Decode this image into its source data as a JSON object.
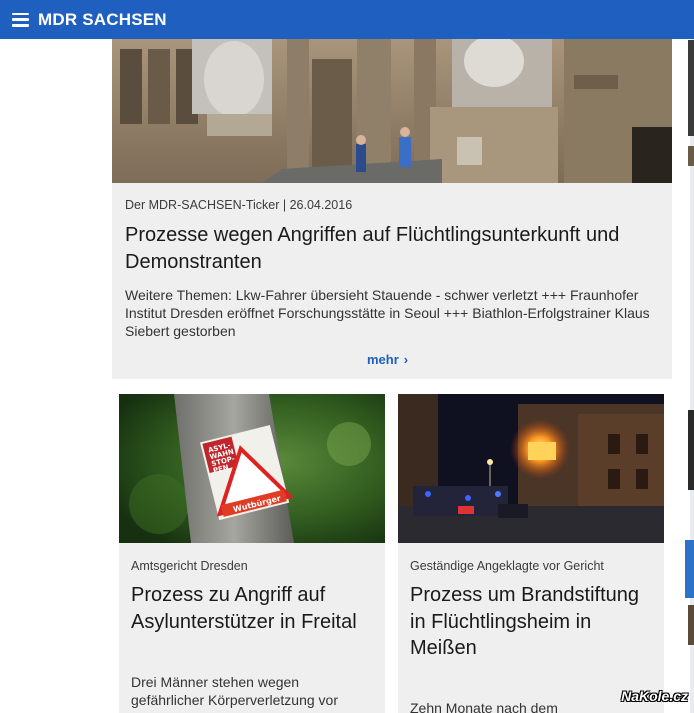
{
  "header": {
    "brand": "MDR SACHSEN",
    "menu_icon": "hamburger-menu-icon",
    "color": "#1f5fbf"
  },
  "lead": {
    "meta": "Der MDR-SACHSEN-Ticker | 26.04.2016",
    "title": "Prozesse wegen Angriffen auf Flüchtlingsunterkunft und Demonstranten",
    "text": "Weitere Themen: Lkw-Fahrer übersieht Stauende - schwer verletzt +++ Fraunhofer Institut Dresden eröffnet Forschungsstätte in Seoul +++ Biathlon-Erfolgstrainer Klaus Siebert gestorben",
    "more": "mehr",
    "more_icon": "chevron-right-icon"
  },
  "cards": [
    {
      "meta": "Amtsgericht Dresden",
      "title": "Prozess zu Angriff auf Asylunterstützer in Freital",
      "text": "Drei Männer stehen wegen gefährlicher Körperverletzung vor",
      "sticker": {
        "line1": "ASYL-",
        "line2": "WAHN",
        "line3": "STOP-",
        "line4": "PEN",
        "badge": "Wutbürger"
      }
    },
    {
      "meta": "Geständige Angeklagte vor Gericht",
      "title": "Prozess um Brandstiftung in Flüchtlingsheim in Meißen",
      "text": "Zehn Monate nach dem"
    }
  ],
  "watermark": "NaKole.cz"
}
